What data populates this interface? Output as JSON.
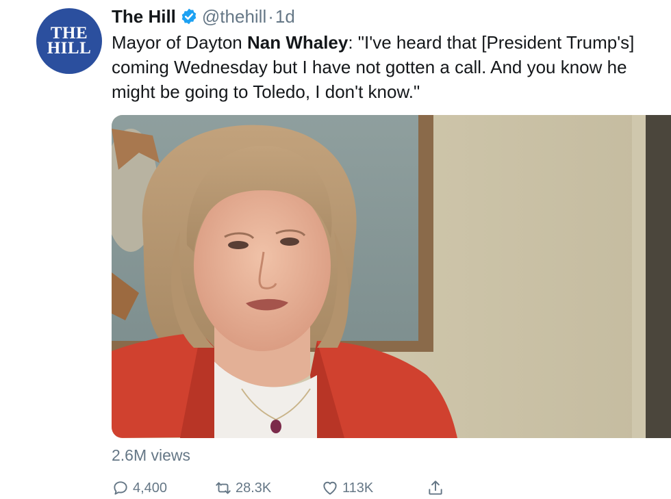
{
  "tweet": {
    "avatar_line1": "THE",
    "avatar_line2": "HILL",
    "display_name": "The Hill",
    "handle": "@thehill",
    "separator": "·",
    "time": "1d",
    "text_part1": "Mayor of Dayton ",
    "text_bold": "Nan Whaley",
    "text_part2": ": \"I've heard that [President Trump's] coming Wednesday but I have not gotten a call. And you know he might be going to Toledo, I don't know.\"",
    "views": "2.6M views",
    "reply_count": "4,400",
    "retweet_count": "28.3K",
    "like_count": "113K"
  },
  "icons": {
    "verified": "verified-badge-icon",
    "reply": "reply-icon",
    "retweet": "retweet-icon",
    "like": "heart-icon",
    "share": "share-icon"
  },
  "colors": {
    "brand_blue": "#2b4f9e",
    "verified_blue": "#1da1f2",
    "muted_text": "#657786",
    "jacket_red": "#d0412f"
  }
}
